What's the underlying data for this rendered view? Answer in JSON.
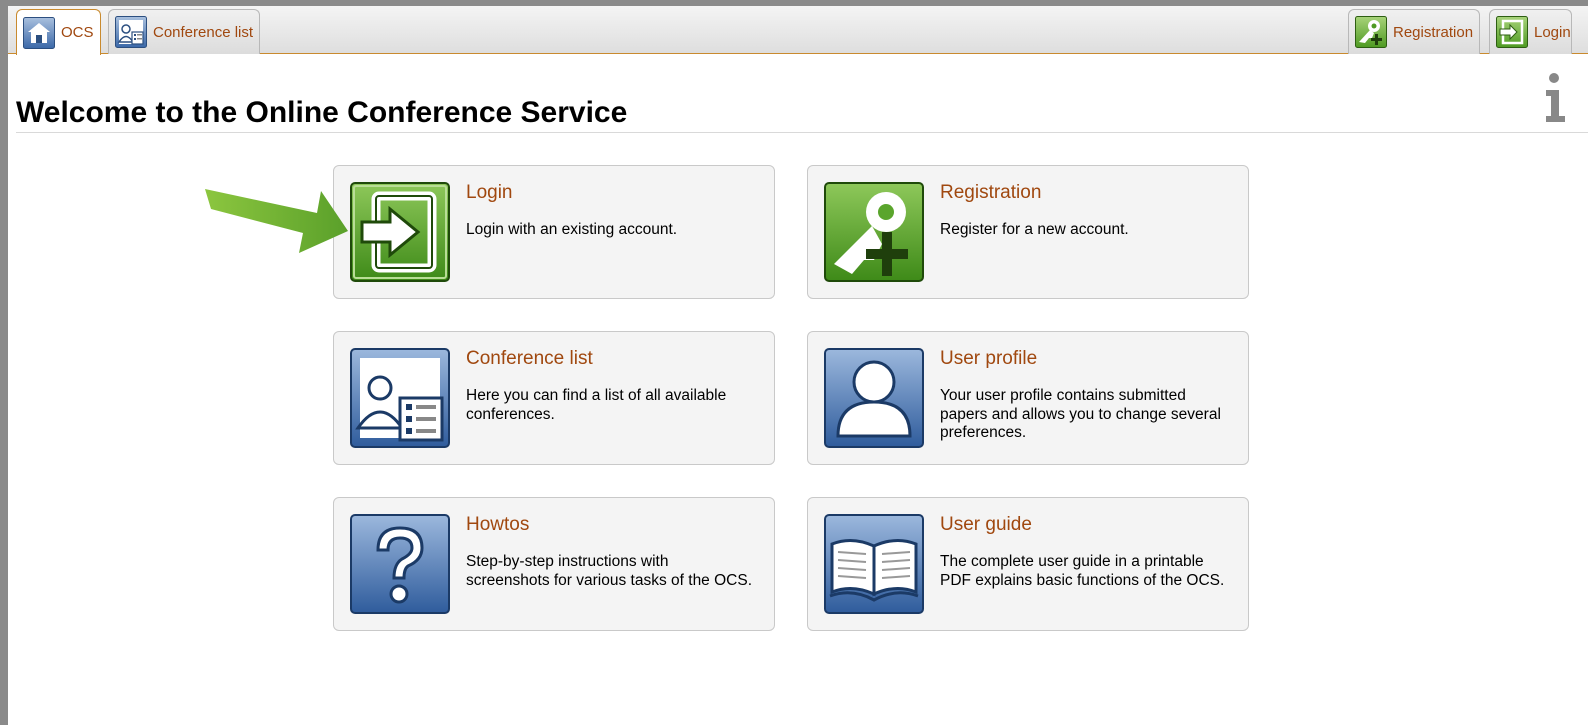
{
  "tabs": {
    "ocs": {
      "label": "OCS",
      "icon": "home-icon"
    },
    "conference_list": {
      "label": "Conference list",
      "icon": "conference-list-icon"
    },
    "registration": {
      "label": "Registration",
      "icon": "registration-icon"
    },
    "login": {
      "label": "Login",
      "icon": "login-icon"
    }
  },
  "page": {
    "title": "Welcome to the Online Conference Service",
    "info_icon": "info-icon"
  },
  "cards": {
    "login": {
      "title": "Login",
      "desc": "Login with an existing account.",
      "icon": "login-icon"
    },
    "registration": {
      "title": "Registration",
      "desc": "Register for a new account.",
      "icon": "registration-icon"
    },
    "conference_list": {
      "title": "Conference list",
      "desc": "Here you can find a list of all available conferences.",
      "icon": "conference-list-icon"
    },
    "user_profile": {
      "title": "User profile",
      "desc": "Your user profile contains submitted papers and allows you to change several preferences.",
      "icon": "user-profile-icon"
    },
    "howtos": {
      "title": "Howtos",
      "desc": "Step-by-step instructions with screenshots for various tasks of the OCS.",
      "icon": "help-icon"
    },
    "user_guide": {
      "title": "User guide",
      "desc": "The complete user guide in a printable PDF explains basic functions of the OCS.",
      "icon": "book-icon"
    }
  },
  "colors": {
    "link": "#a0480f",
    "green_icon": "#5fa82b",
    "blue_icon": "#3b68a8",
    "highlight_arrow": "#6ab22e"
  }
}
